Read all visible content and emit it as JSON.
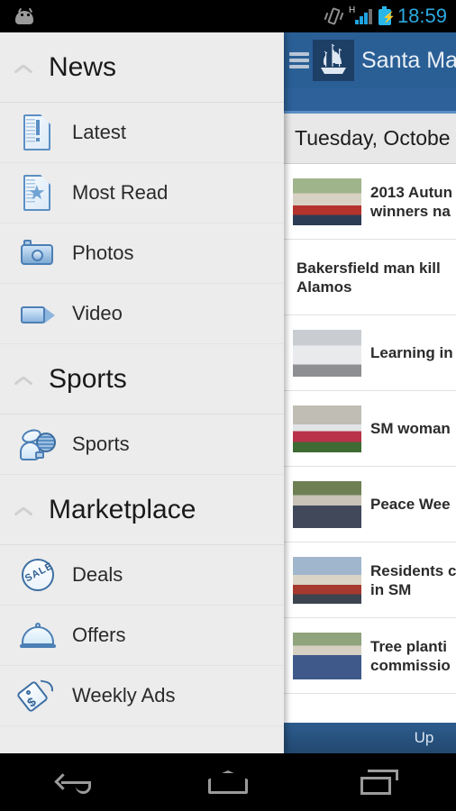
{
  "statusbar": {
    "time": "18:59",
    "icons": [
      "android-robot-icon",
      "vibrate-icon",
      "signal-h-icon",
      "battery-charging-icon"
    ],
    "network_type": "H"
  },
  "appbar": {
    "menu_icon": "hamburger-menu-icon",
    "logo_icon": "ship-logo-icon",
    "title": "Santa Mari"
  },
  "content": {
    "date_header": "Tuesday, Octobe",
    "update_bar_label": "Up",
    "articles": [
      {
        "title_line1": "2013 Autun",
        "title_line2": "winners na",
        "has_thumb": true,
        "thumb": "people-working-thumb"
      },
      {
        "title_line1": "Bakersfield man kill",
        "title_line2": "Alamos",
        "has_thumb": false,
        "thumb": ""
      },
      {
        "title_line1": "Learning in",
        "title_line2": "",
        "has_thumb": true,
        "thumb": "white-car-thumb"
      },
      {
        "title_line1": "SM woman",
        "title_line2": "",
        "has_thumb": true,
        "thumb": "flowers-memorial-thumb"
      },
      {
        "title_line1": "Peace Wee",
        "title_line2": "",
        "has_thumb": true,
        "thumb": "two-men-thumb"
      },
      {
        "title_line1": "Residents c",
        "title_line2": "in SM",
        "has_thumb": true,
        "thumb": "crowd-thumb"
      },
      {
        "title_line1": "Tree planti",
        "title_line2": "commissio",
        "has_thumb": true,
        "thumb": "men-outdoors-thumb"
      }
    ]
  },
  "drawer": {
    "sections": [
      {
        "title": "News",
        "collapse_icon": "chevron-up-icon",
        "items": [
          {
            "label": "Latest",
            "icon": "document-alert-icon"
          },
          {
            "label": "Most Read",
            "icon": "document-star-icon"
          },
          {
            "label": "Photos",
            "icon": "camera-icon"
          },
          {
            "label": "Video",
            "icon": "video-camera-icon"
          }
        ]
      },
      {
        "title": "Sports",
        "collapse_icon": "chevron-up-icon",
        "items": [
          {
            "label": "Sports",
            "icon": "sports-balls-icon"
          }
        ]
      },
      {
        "title": "Marketplace",
        "collapse_icon": "chevron-up-icon",
        "items": [
          {
            "label": "Deals",
            "icon": "sale-sticker-icon"
          },
          {
            "label": "Offers",
            "icon": "cloche-icon"
          },
          {
            "label": "Weekly Ads",
            "icon": "price-tag-icon"
          }
        ]
      }
    ]
  },
  "navbar": {
    "buttons": [
      {
        "name": "back-button",
        "icon": "back-arrow-icon"
      },
      {
        "name": "home-button",
        "icon": "home-icon"
      },
      {
        "name": "recents-button",
        "icon": "recents-icon"
      }
    ]
  },
  "colors": {
    "appbar_blue": "#2a5f96",
    "logo_navy": "#1d3f66",
    "drawer_bg": "#ececec",
    "accent_blue": "#2ca9e0",
    "icon_outline": "#4c7fb5"
  }
}
